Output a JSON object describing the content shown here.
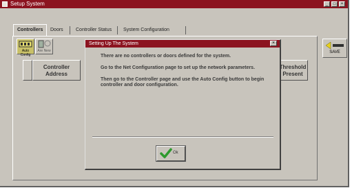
{
  "window": {
    "title": "Setup System"
  },
  "tabs": [
    {
      "label": "Controllers",
      "active": true
    },
    {
      "label": "Doors",
      "active": false
    },
    {
      "label": "Controller Status",
      "active": false
    },
    {
      "label": "System Configuration",
      "active": false
    }
  ],
  "toolbar": {
    "auto_config_label": "Auto Config",
    "new_label": "Are New",
    "save_label": "SAVE"
  },
  "grid": {
    "columns": [
      "Controller Address",
      "Threshold Present"
    ]
  },
  "dialog": {
    "title": "Setting Up The System",
    "close_glyph": "×",
    "paragraphs": [
      "There are no controllers or doors defined for the system.",
      "Go to the Net Configuration page to set up the network parameters.",
      "Then go to the Controller page and use the Auto Config button to begin controller and door configuration."
    ],
    "ok_label": "Ok"
  },
  "colors": {
    "titlebar": "#8c1420",
    "face": "#c8c4bc",
    "ok_check": "#2e9a2e"
  }
}
